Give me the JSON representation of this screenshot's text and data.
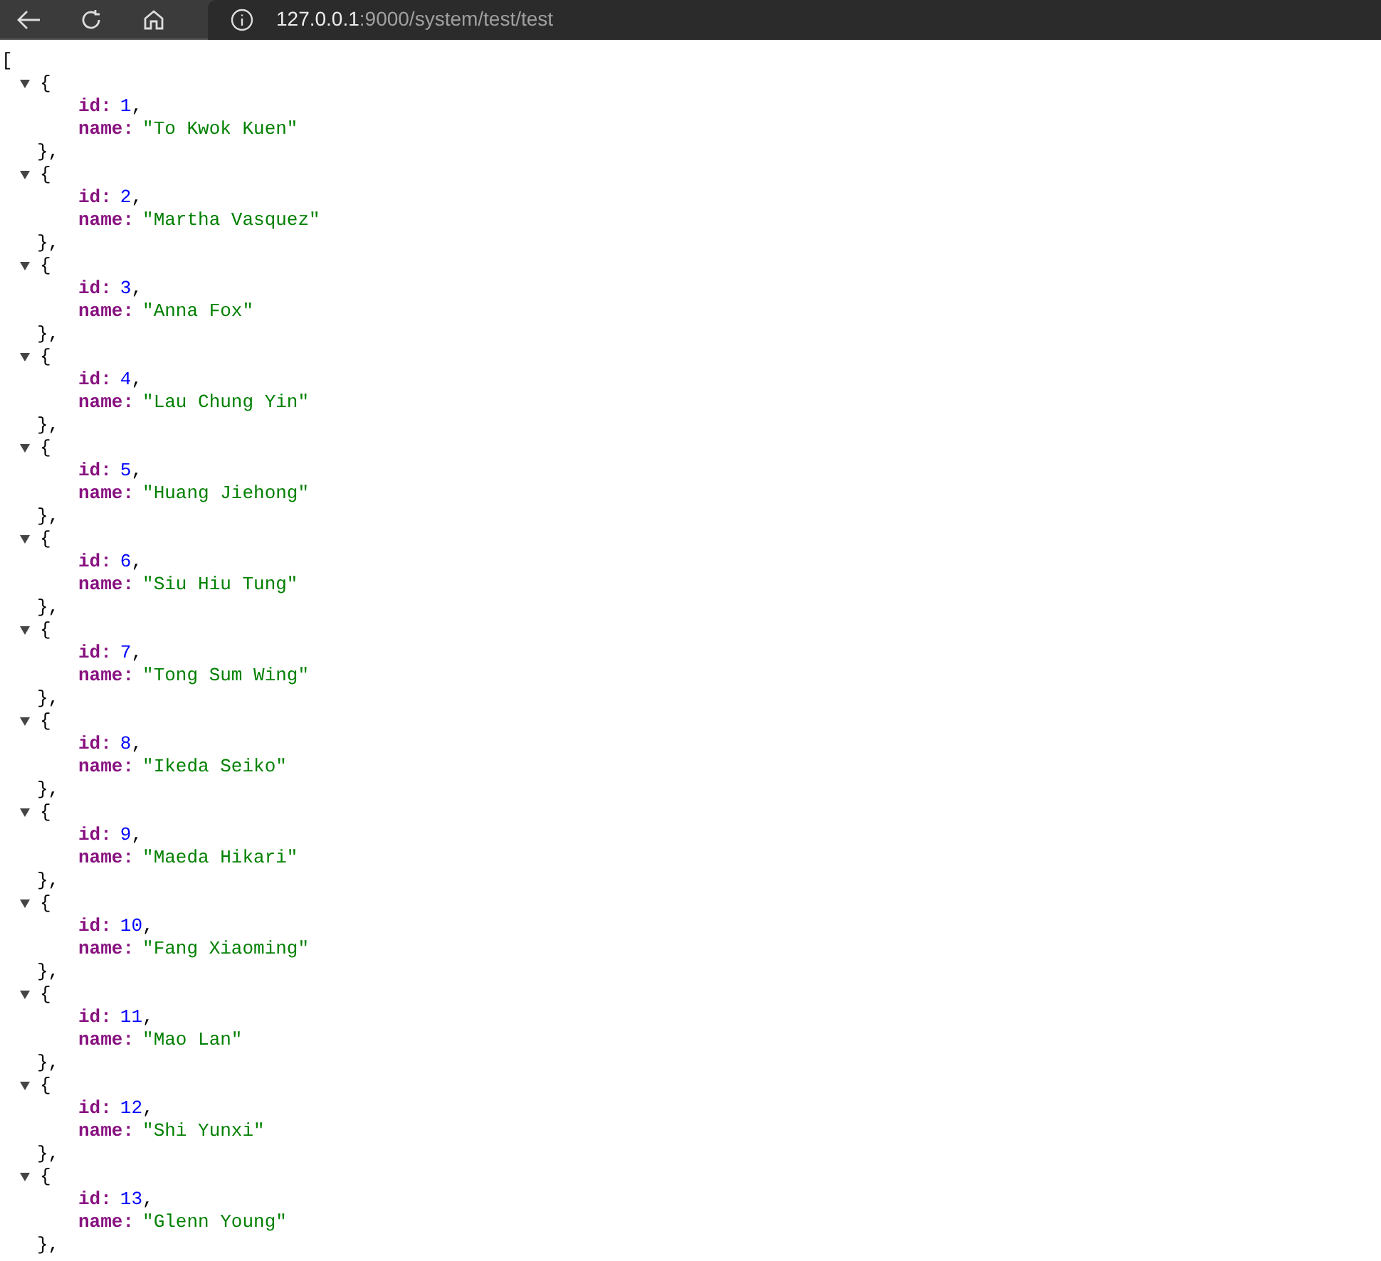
{
  "toolbar": {
    "address": {
      "host": "127.0.0.1",
      "path": ":9000/system/test/test"
    }
  },
  "viewer": {
    "open": "[",
    "items": [
      {
        "expanded": true,
        "open": "{",
        "close": "},",
        "fields": [
          {
            "key": "id:",
            "kind": "number",
            "value": "1",
            "punct": ","
          },
          {
            "key": "name:",
            "kind": "string",
            "value": "\"To Kwok Kuen\""
          }
        ]
      },
      {
        "expanded": true,
        "open": "{",
        "close": "},",
        "fields": [
          {
            "key": "id:",
            "kind": "number",
            "value": "2",
            "punct": ","
          },
          {
            "key": "name:",
            "kind": "string",
            "value": "\"Martha Vasquez\""
          }
        ]
      },
      {
        "expanded": true,
        "open": "{",
        "close": "},",
        "fields": [
          {
            "key": "id:",
            "kind": "number",
            "value": "3",
            "punct": ","
          },
          {
            "key": "name:",
            "kind": "string",
            "value": "\"Anna Fox\""
          }
        ]
      },
      {
        "expanded": true,
        "open": "{",
        "close": "},",
        "fields": [
          {
            "key": "id:",
            "kind": "number",
            "value": "4",
            "punct": ","
          },
          {
            "key": "name:",
            "kind": "string",
            "value": "\"Lau Chung Yin\""
          }
        ]
      },
      {
        "expanded": true,
        "open": "{",
        "close": "},",
        "fields": [
          {
            "key": "id:",
            "kind": "number",
            "value": "5",
            "punct": ","
          },
          {
            "key": "name:",
            "kind": "string",
            "value": "\"Huang Jiehong\""
          }
        ]
      },
      {
        "expanded": true,
        "open": "{",
        "close": "},",
        "fields": [
          {
            "key": "id:",
            "kind": "number",
            "value": "6",
            "punct": ","
          },
          {
            "key": "name:",
            "kind": "string",
            "value": "\"Siu Hiu Tung\""
          }
        ]
      },
      {
        "expanded": true,
        "open": "{",
        "close": "},",
        "fields": [
          {
            "key": "id:",
            "kind": "number",
            "value": "7",
            "punct": ","
          },
          {
            "key": "name:",
            "kind": "string",
            "value": "\"Tong Sum Wing\""
          }
        ]
      },
      {
        "expanded": true,
        "open": "{",
        "close": "},",
        "fields": [
          {
            "key": "id:",
            "kind": "number",
            "value": "8",
            "punct": ","
          },
          {
            "key": "name:",
            "kind": "string",
            "value": "\"Ikeda Seiko\""
          }
        ]
      },
      {
        "expanded": true,
        "open": "{",
        "close": "},",
        "fields": [
          {
            "key": "id:",
            "kind": "number",
            "value": "9",
            "punct": ","
          },
          {
            "key": "name:",
            "kind": "string",
            "value": "\"Maeda Hikari\""
          }
        ]
      },
      {
        "expanded": true,
        "open": "{",
        "close": "},",
        "fields": [
          {
            "key": "id:",
            "kind": "number",
            "value": "10",
            "punct": ","
          },
          {
            "key": "name:",
            "kind": "string",
            "value": "\"Fang Xiaoming\""
          }
        ]
      },
      {
        "expanded": true,
        "open": "{",
        "close": "},",
        "fields": [
          {
            "key": "id:",
            "kind": "number",
            "value": "11",
            "punct": ","
          },
          {
            "key": "name:",
            "kind": "string",
            "value": "\"Mao Lan\""
          }
        ]
      },
      {
        "expanded": true,
        "open": "{",
        "close": "},",
        "fields": [
          {
            "key": "id:",
            "kind": "number",
            "value": "12",
            "punct": ","
          },
          {
            "key": "name:",
            "kind": "string",
            "value": "\"Shi Yunxi\""
          }
        ]
      },
      {
        "expanded": true,
        "open": "{",
        "close": "},",
        "fields": [
          {
            "key": "id:",
            "kind": "number",
            "value": "13",
            "punct": ","
          },
          {
            "key": "name:",
            "kind": "string",
            "value": "\"Glenn Young\""
          }
        ]
      }
    ]
  }
}
